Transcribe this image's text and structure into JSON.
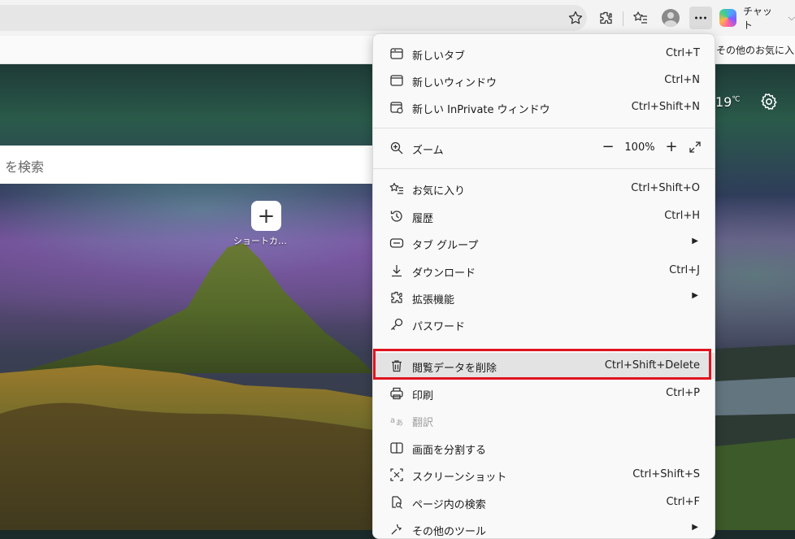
{
  "toolbar": {
    "favorites_star_icon": "star-add-icon",
    "extensions_icon": "puzzle-icon",
    "favorites_icon": "favorites-list-icon",
    "profile_icon": "avatar",
    "more_icon": "ellipsis-icon",
    "chat_label": "チャット"
  },
  "favorites_bar": {
    "other_favorites": "その他のお気に入り"
  },
  "page": {
    "search_placeholder": "を検索",
    "shortcut_label": "ショートカ…",
    "temperature": "19",
    "temperature_unit": "℃"
  },
  "menu": {
    "items": [
      {
        "label": "新しいタブ",
        "shortcut": "Ctrl+T",
        "icon": "new-tab-icon"
      },
      {
        "label": "新しいウィンドウ",
        "shortcut": "Ctrl+N",
        "icon": "new-window-icon"
      },
      {
        "label": "新しい InPrivate ウィンドウ",
        "shortcut": "Ctrl+Shift+N",
        "icon": "inprivate-window-icon"
      },
      {
        "label": "ズーム",
        "icon": "zoom-icon",
        "zoom_minus": "−",
        "zoom_value": "100%",
        "zoom_plus": "+"
      },
      {
        "label": "お気に入り",
        "shortcut": "Ctrl+Shift+O",
        "icon": "favorites-icon"
      },
      {
        "label": "履歴",
        "shortcut": "Ctrl+H",
        "icon": "history-icon"
      },
      {
        "label": "タブ グループ",
        "icon": "tab-groups-icon",
        "arrow": "▶"
      },
      {
        "label": "ダウンロード",
        "shortcut": "Ctrl+J",
        "icon": "download-icon"
      },
      {
        "label": "拡張機能",
        "icon": "extensions-icon",
        "arrow": "▶"
      },
      {
        "label": "パスワード",
        "icon": "key-icon"
      },
      {
        "label": "閲覧データを削除",
        "shortcut": "Ctrl+Shift+Delete",
        "icon": "trash-icon"
      },
      {
        "label": "印刷",
        "shortcut": "Ctrl+P",
        "icon": "print-icon"
      },
      {
        "label": "翻訳",
        "icon": "translate-icon"
      },
      {
        "label": "画面を分割する",
        "icon": "split-screen-icon"
      },
      {
        "label": "スクリーンショット",
        "shortcut": "Ctrl+Shift+S",
        "icon": "screenshot-icon"
      },
      {
        "label": "ページ内の検索",
        "shortcut": "Ctrl+F",
        "icon": "find-in-page-icon"
      },
      {
        "label": "その他のツール",
        "icon": "tools-icon",
        "arrow": "▶"
      }
    ]
  },
  "colors": {
    "highlight_border": "#e0141e",
    "menu_background": "#f9f9f9",
    "toolbar_background": "#f3f3f3"
  }
}
